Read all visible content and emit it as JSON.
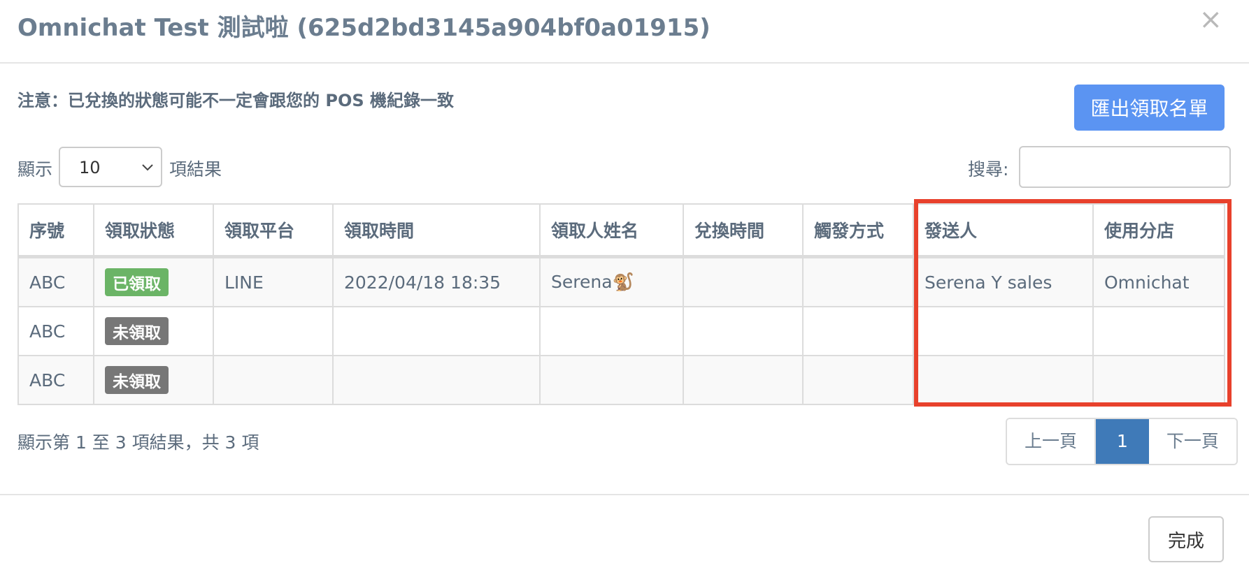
{
  "modal": {
    "title": "Omnichat Test 測試啦 (625d2bd3145a904bf0a01915)",
    "close_symbol": "×",
    "notice": "注意：已兌換的狀態可能不一定會跟您的 POS 機紀錄一致",
    "export_label": "匯出領取名單"
  },
  "controls": {
    "length_label": "顯示",
    "length_value": "10",
    "length_suffix": "項結果",
    "search_label": "搜尋:",
    "search_value": ""
  },
  "table": {
    "headers": [
      "序號",
      "領取狀態",
      "領取平台",
      "領取時間",
      "領取人姓名",
      "兌換時間",
      "觸發方式",
      "發送人",
      "使用分店"
    ],
    "rows": [
      {
        "serial": "ABC",
        "status": "已領取",
        "platform": "LINE",
        "time": "2022/04/18 18:35",
        "name": "Serena🐒",
        "redeem_time": "",
        "trigger": "",
        "sender": "Serena Y sales",
        "branch": "Omnichat"
      },
      {
        "serial": "ABC",
        "status": "未領取",
        "platform": "",
        "time": "",
        "name": "",
        "redeem_time": "",
        "trigger": "",
        "sender": "",
        "branch": ""
      },
      {
        "serial": "ABC",
        "status": "未領取",
        "platform": "",
        "time": "",
        "name": "",
        "redeem_time": "",
        "trigger": "",
        "sender": "",
        "branch": ""
      }
    ]
  },
  "pagination": {
    "info": "顯示第 1 至 3 項結果，共 3 項",
    "prev": "上一頁",
    "current": "1",
    "next": "下一頁"
  },
  "footer": {
    "done_label": "完成"
  },
  "colors": {
    "primary_button": "#5b94f2",
    "badge_received": "#6bb466",
    "badge_unreceived": "#777777",
    "page_active": "#3f7ab8",
    "highlight_border": "#e8412c"
  }
}
